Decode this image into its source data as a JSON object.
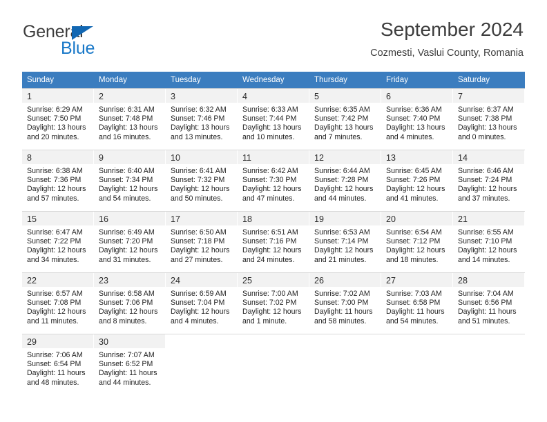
{
  "brand": {
    "name_top": "General",
    "name_bottom": "Blue",
    "color_dark": "#3d3d3d",
    "color_blue": "#1878c8"
  },
  "header": {
    "title": "September 2024",
    "location": "Cozmesti, Vaslui County, Romania"
  },
  "calendar": {
    "header_bg": "#3b7dbf",
    "daynum_bg": "#f2f2f2",
    "weekdays": [
      "Sunday",
      "Monday",
      "Tuesday",
      "Wednesday",
      "Thursday",
      "Friday",
      "Saturday"
    ],
    "weeks": [
      [
        {
          "day": "1",
          "sunrise": "Sunrise: 6:29 AM",
          "sunset": "Sunset: 7:50 PM",
          "daylight_1": "Daylight: 13 hours",
          "daylight_2": "and 20 minutes."
        },
        {
          "day": "2",
          "sunrise": "Sunrise: 6:31 AM",
          "sunset": "Sunset: 7:48 PM",
          "daylight_1": "Daylight: 13 hours",
          "daylight_2": "and 16 minutes."
        },
        {
          "day": "3",
          "sunrise": "Sunrise: 6:32 AM",
          "sunset": "Sunset: 7:46 PM",
          "daylight_1": "Daylight: 13 hours",
          "daylight_2": "and 13 minutes."
        },
        {
          "day": "4",
          "sunrise": "Sunrise: 6:33 AM",
          "sunset": "Sunset: 7:44 PM",
          "daylight_1": "Daylight: 13 hours",
          "daylight_2": "and 10 minutes."
        },
        {
          "day": "5",
          "sunrise": "Sunrise: 6:35 AM",
          "sunset": "Sunset: 7:42 PM",
          "daylight_1": "Daylight: 13 hours",
          "daylight_2": "and 7 minutes."
        },
        {
          "day": "6",
          "sunrise": "Sunrise: 6:36 AM",
          "sunset": "Sunset: 7:40 PM",
          "daylight_1": "Daylight: 13 hours",
          "daylight_2": "and 4 minutes."
        },
        {
          "day": "7",
          "sunrise": "Sunrise: 6:37 AM",
          "sunset": "Sunset: 7:38 PM",
          "daylight_1": "Daylight: 13 hours",
          "daylight_2": "and 0 minutes."
        }
      ],
      [
        {
          "day": "8",
          "sunrise": "Sunrise: 6:38 AM",
          "sunset": "Sunset: 7:36 PM",
          "daylight_1": "Daylight: 12 hours",
          "daylight_2": "and 57 minutes."
        },
        {
          "day": "9",
          "sunrise": "Sunrise: 6:40 AM",
          "sunset": "Sunset: 7:34 PM",
          "daylight_1": "Daylight: 12 hours",
          "daylight_2": "and 54 minutes."
        },
        {
          "day": "10",
          "sunrise": "Sunrise: 6:41 AM",
          "sunset": "Sunset: 7:32 PM",
          "daylight_1": "Daylight: 12 hours",
          "daylight_2": "and 50 minutes."
        },
        {
          "day": "11",
          "sunrise": "Sunrise: 6:42 AM",
          "sunset": "Sunset: 7:30 PM",
          "daylight_1": "Daylight: 12 hours",
          "daylight_2": "and 47 minutes."
        },
        {
          "day": "12",
          "sunrise": "Sunrise: 6:44 AM",
          "sunset": "Sunset: 7:28 PM",
          "daylight_1": "Daylight: 12 hours",
          "daylight_2": "and 44 minutes."
        },
        {
          "day": "13",
          "sunrise": "Sunrise: 6:45 AM",
          "sunset": "Sunset: 7:26 PM",
          "daylight_1": "Daylight: 12 hours",
          "daylight_2": "and 41 minutes."
        },
        {
          "day": "14",
          "sunrise": "Sunrise: 6:46 AM",
          "sunset": "Sunset: 7:24 PM",
          "daylight_1": "Daylight: 12 hours",
          "daylight_2": "and 37 minutes."
        }
      ],
      [
        {
          "day": "15",
          "sunrise": "Sunrise: 6:47 AM",
          "sunset": "Sunset: 7:22 PM",
          "daylight_1": "Daylight: 12 hours",
          "daylight_2": "and 34 minutes."
        },
        {
          "day": "16",
          "sunrise": "Sunrise: 6:49 AM",
          "sunset": "Sunset: 7:20 PM",
          "daylight_1": "Daylight: 12 hours",
          "daylight_2": "and 31 minutes."
        },
        {
          "day": "17",
          "sunrise": "Sunrise: 6:50 AM",
          "sunset": "Sunset: 7:18 PM",
          "daylight_1": "Daylight: 12 hours",
          "daylight_2": "and 27 minutes."
        },
        {
          "day": "18",
          "sunrise": "Sunrise: 6:51 AM",
          "sunset": "Sunset: 7:16 PM",
          "daylight_1": "Daylight: 12 hours",
          "daylight_2": "and 24 minutes."
        },
        {
          "day": "19",
          "sunrise": "Sunrise: 6:53 AM",
          "sunset": "Sunset: 7:14 PM",
          "daylight_1": "Daylight: 12 hours",
          "daylight_2": "and 21 minutes."
        },
        {
          "day": "20",
          "sunrise": "Sunrise: 6:54 AM",
          "sunset": "Sunset: 7:12 PM",
          "daylight_1": "Daylight: 12 hours",
          "daylight_2": "and 18 minutes."
        },
        {
          "day": "21",
          "sunrise": "Sunrise: 6:55 AM",
          "sunset": "Sunset: 7:10 PM",
          "daylight_1": "Daylight: 12 hours",
          "daylight_2": "and 14 minutes."
        }
      ],
      [
        {
          "day": "22",
          "sunrise": "Sunrise: 6:57 AM",
          "sunset": "Sunset: 7:08 PM",
          "daylight_1": "Daylight: 12 hours",
          "daylight_2": "and 11 minutes."
        },
        {
          "day": "23",
          "sunrise": "Sunrise: 6:58 AM",
          "sunset": "Sunset: 7:06 PM",
          "daylight_1": "Daylight: 12 hours",
          "daylight_2": "and 8 minutes."
        },
        {
          "day": "24",
          "sunrise": "Sunrise: 6:59 AM",
          "sunset": "Sunset: 7:04 PM",
          "daylight_1": "Daylight: 12 hours",
          "daylight_2": "and 4 minutes."
        },
        {
          "day": "25",
          "sunrise": "Sunrise: 7:00 AM",
          "sunset": "Sunset: 7:02 PM",
          "daylight_1": "Daylight: 12 hours",
          "daylight_2": "and 1 minute."
        },
        {
          "day": "26",
          "sunrise": "Sunrise: 7:02 AM",
          "sunset": "Sunset: 7:00 PM",
          "daylight_1": "Daylight: 11 hours",
          "daylight_2": "and 58 minutes."
        },
        {
          "day": "27",
          "sunrise": "Sunrise: 7:03 AM",
          "sunset": "Sunset: 6:58 PM",
          "daylight_1": "Daylight: 11 hours",
          "daylight_2": "and 54 minutes."
        },
        {
          "day": "28",
          "sunrise": "Sunrise: 7:04 AM",
          "sunset": "Sunset: 6:56 PM",
          "daylight_1": "Daylight: 11 hours",
          "daylight_2": "and 51 minutes."
        }
      ],
      [
        {
          "day": "29",
          "sunrise": "Sunrise: 7:06 AM",
          "sunset": "Sunset: 6:54 PM",
          "daylight_1": "Daylight: 11 hours",
          "daylight_2": "and 48 minutes."
        },
        {
          "day": "30",
          "sunrise": "Sunrise: 7:07 AM",
          "sunset": "Sunset: 6:52 PM",
          "daylight_1": "Daylight: 11 hours",
          "daylight_2": "and 44 minutes."
        },
        {
          "day": "",
          "sunrise": "",
          "sunset": "",
          "daylight_1": "",
          "daylight_2": ""
        },
        {
          "day": "",
          "sunrise": "",
          "sunset": "",
          "daylight_1": "",
          "daylight_2": ""
        },
        {
          "day": "",
          "sunrise": "",
          "sunset": "",
          "daylight_1": "",
          "daylight_2": ""
        },
        {
          "day": "",
          "sunrise": "",
          "sunset": "",
          "daylight_1": "",
          "daylight_2": ""
        },
        {
          "day": "",
          "sunrise": "",
          "sunset": "",
          "daylight_1": "",
          "daylight_2": ""
        }
      ]
    ]
  }
}
